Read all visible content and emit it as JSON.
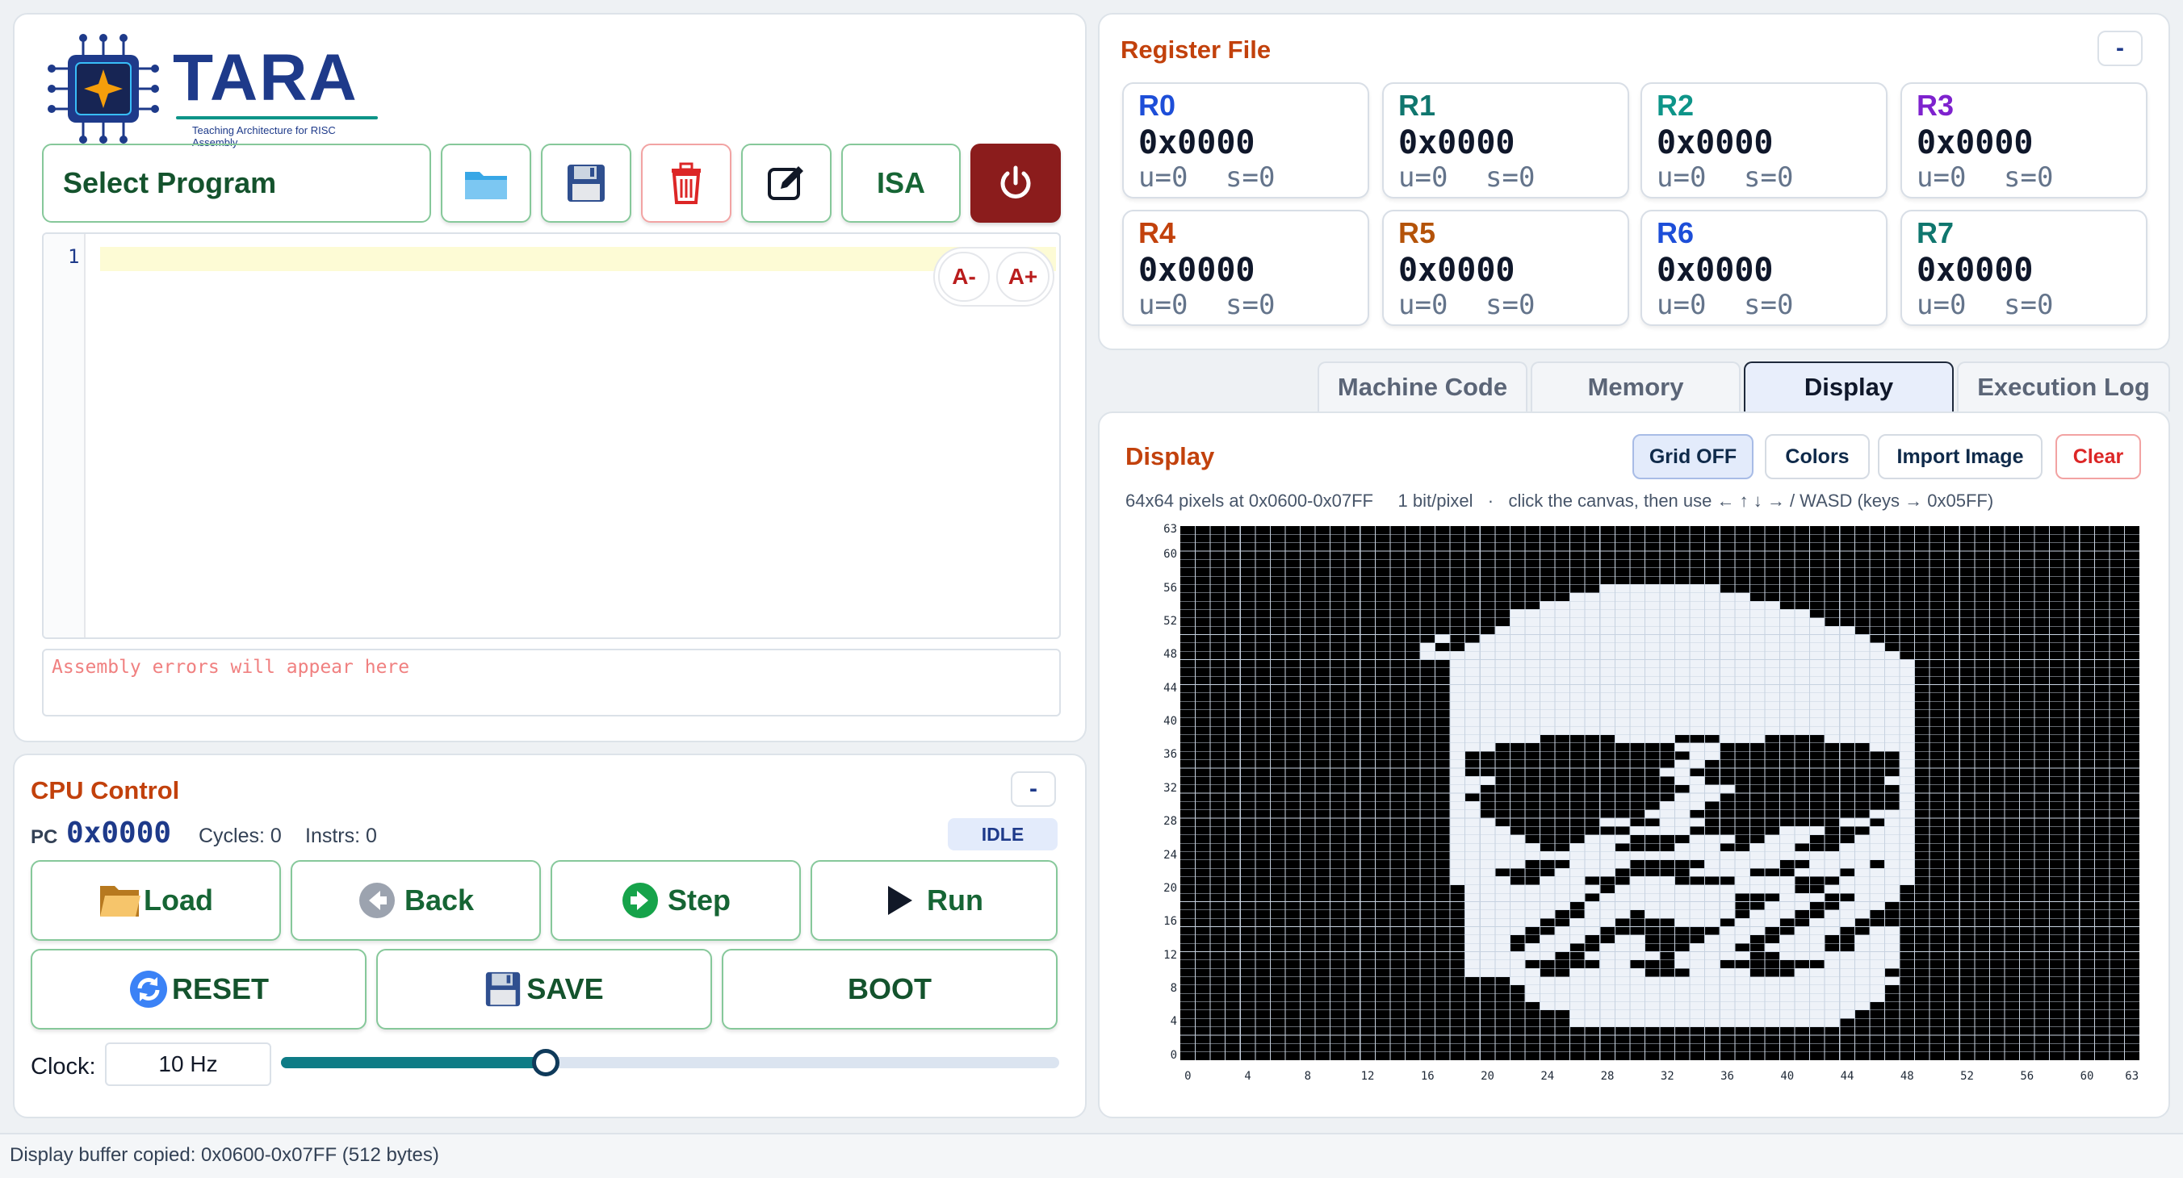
{
  "brand": {
    "name": "TARA",
    "tagline": "Teaching Architecture for RISC Assembly"
  },
  "toolbar": {
    "program_select": "Select Program",
    "isa_label": "ISA"
  },
  "editor": {
    "line_numbers": [
      "1"
    ],
    "font_decrease": "A-",
    "font_increase": "A+",
    "errors_placeholder": "Assembly errors will appear here"
  },
  "cpu": {
    "title": "CPU Control",
    "collapse": "-",
    "pc_label": "PC",
    "pc_value": "0x0000",
    "cycles": "Cycles: 0",
    "instrs": "Instrs: 0",
    "status": "IDLE",
    "buttons": {
      "load": "Load",
      "back": "Back",
      "step": "Step",
      "run": "Run",
      "reset": "RESET",
      "save": "SAVE",
      "boot": "BOOT"
    },
    "clock_label": "Clock:",
    "clock_value": "10 Hz",
    "clock_level_fraction": 0.34
  },
  "registers": {
    "title": "Register File",
    "collapse": "-",
    "items": [
      {
        "name": "R0",
        "value": "0x0000",
        "u": "u=0",
        "s": "s=0",
        "color": "#1d4ed8"
      },
      {
        "name": "R1",
        "value": "0x0000",
        "u": "u=0",
        "s": "s=0",
        "color": "#0f766e"
      },
      {
        "name": "R2",
        "value": "0x0000",
        "u": "u=0",
        "s": "s=0",
        "color": "#0d9488"
      },
      {
        "name": "R3",
        "value": "0x0000",
        "u": "u=0",
        "s": "s=0",
        "color": "#7e22ce"
      },
      {
        "name": "R4",
        "value": "0x0000",
        "u": "u=0",
        "s": "s=0",
        "color": "#c2410c"
      },
      {
        "name": "R5",
        "value": "0x0000",
        "u": "u=0",
        "s": "s=0",
        "color": "#b45309"
      },
      {
        "name": "R6",
        "value": "0x0000",
        "u": "u=0",
        "s": "s=0",
        "color": "#1d4ed8"
      },
      {
        "name": "R7",
        "value": "0x0000",
        "u": "u=0",
        "s": "s=0",
        "color": "#0f766e"
      }
    ]
  },
  "tabs": [
    "Machine Code",
    "Memory",
    "Display",
    "Execution Log"
  ],
  "display": {
    "title": "Display",
    "buttons": {
      "grid": "Grid OFF",
      "colors": "Colors",
      "import": "Import Image",
      "clear": "Clear"
    },
    "info": "64x64 pixels at 0x0600-0x07FF     1 bit/pixel   ·   click the canvas, then use ← ↑ ↓ → / WASD (keys → 0x05FF)",
    "y_ticks": [
      "0",
      "4",
      "8",
      "12",
      "16",
      "20",
      "24",
      "28",
      "32",
      "36",
      "40",
      "44",
      "48",
      "52",
      "56",
      "60",
      "63"
    ],
    "x_ticks": [
      "0",
      "4",
      "8",
      "12",
      "16",
      "20",
      "24",
      "28",
      "32",
      "36",
      "40",
      "44",
      "48",
      "52",
      "56",
      "60",
      "63"
    ],
    "size": 64,
    "lit_ranges": [
      [
        4,
        [
          [
            26,
            43
          ]
        ]
      ],
      [
        5,
        [
          [
            26,
            44
          ]
        ]
      ],
      [
        6,
        [
          [
            24,
            45
          ]
        ]
      ],
      [
        7,
        [
          [
            23,
            46
          ]
        ]
      ],
      [
        8,
        [
          [
            23,
            46
          ]
        ]
      ],
      [
        9,
        [
          [
            22,
            47
          ]
        ]
      ],
      [
        10,
        [
          [
            19,
            23
          ],
          [
            26,
            30
          ],
          [
            34,
            37
          ],
          [
            41,
            46
          ]
        ]
      ],
      [
        11,
        [
          [
            19,
            22
          ],
          [
            28,
            29
          ],
          [
            33,
            35
          ],
          [
            43,
            47
          ]
        ]
      ],
      [
        12,
        [
          [
            19,
            24
          ],
          [
            27,
            31
          ],
          [
            33,
            37
          ],
          [
            40,
            47
          ]
        ]
      ],
      [
        13,
        [
          [
            19,
            21
          ],
          [
            23,
            25
          ],
          [
            28,
            30
          ],
          [
            34,
            36
          ],
          [
            39,
            42
          ],
          [
            45,
            47
          ]
        ]
      ],
      [
        14,
        [
          [
            19,
            21
          ],
          [
            24,
            26
          ],
          [
            29,
            30
          ],
          [
            35,
            37
          ],
          [
            40,
            42
          ],
          [
            45,
            47
          ]
        ]
      ],
      [
        15,
        [
          [
            19,
            22
          ],
          [
            25,
            27
          ],
          [
            36,
            38
          ],
          [
            41,
            43
          ],
          [
            46,
            47
          ]
        ]
      ],
      [
        16,
        [
          [
            19,
            23
          ],
          [
            26,
            28
          ],
          [
            33,
            35
          ],
          [
            37,
            39
          ],
          [
            42,
            44
          ]
        ]
      ],
      [
        17,
        [
          [
            19,
            24
          ],
          [
            27,
            29
          ],
          [
            31,
            36
          ],
          [
            38,
            40
          ],
          [
            43,
            45
          ]
        ]
      ],
      [
        18,
        [
          [
            19,
            25
          ],
          [
            27,
            36
          ],
          [
            39,
            41
          ],
          [
            44,
            46
          ]
        ]
      ],
      [
        19,
        [
          [
            19,
            26
          ],
          [
            28,
            36
          ],
          [
            40,
            42
          ],
          [
            45,
            47
          ]
        ]
      ],
      [
        20,
        [
          [
            19,
            27
          ],
          [
            29,
            40
          ],
          [
            43,
            47
          ]
        ]
      ],
      [
        21,
        [
          [
            18,
            21
          ],
          [
            24,
            26
          ],
          [
            30,
            32
          ],
          [
            37,
            40
          ],
          [
            44,
            48
          ]
        ]
      ],
      [
        22,
        [
          [
            18,
            20
          ],
          [
            25,
            28
          ],
          [
            34,
            37
          ],
          [
            41,
            43
          ],
          [
            45,
            48
          ]
        ]
      ],
      [
        23,
        [
          [
            18,
            22
          ],
          [
            26,
            29
          ],
          [
            35,
            39
          ],
          [
            42,
            45
          ],
          [
            47,
            48
          ]
        ]
      ],
      [
        24,
        [
          [
            18,
            48
          ]
        ]
      ],
      [
        25,
        [
          [
            18,
            23
          ],
          [
            26,
            28
          ],
          [
            33,
            35
          ],
          [
            38,
            40
          ],
          [
            44,
            48
          ]
        ]
      ],
      [
        26,
        [
          [
            18,
            22
          ],
          [
            27,
            29
          ],
          [
            34,
            36
          ],
          [
            39,
            41
          ],
          [
            45,
            48
          ]
        ]
      ],
      [
        27,
        [
          [
            18,
            21
          ],
          [
            30,
            33
          ],
          [
            40,
            42
          ],
          [
            46,
            48
          ]
        ]
      ],
      [
        28,
        [
          [
            18,
            20
          ],
          [
            28,
            29
          ],
          [
            32,
            34
          ],
          [
            44,
            45
          ],
          [
            47,
            48
          ]
        ]
      ],
      [
        29,
        [
          [
            18,
            19
          ],
          [
            31,
            33
          ],
          [
            46,
            48
          ]
        ]
      ],
      [
        30,
        [
          [
            18,
            19
          ],
          [
            32,
            34
          ],
          [
            48,
            48
          ]
        ]
      ],
      [
        31,
        [
          [
            18,
            18
          ],
          [
            33,
            35
          ],
          [
            48,
            48
          ]
        ]
      ],
      [
        32,
        [
          [
            18,
            19
          ],
          [
            34,
            36
          ],
          [
            48,
            48
          ]
        ]
      ],
      [
        33,
        [
          [
            18,
            20
          ],
          [
            33,
            34
          ],
          [
            47,
            48
          ]
        ]
      ],
      [
        34,
        [
          [
            18,
            18
          ],
          [
            32,
            33
          ],
          [
            48,
            48
          ]
        ]
      ],
      [
        35,
        [
          [
            18,
            18
          ],
          [
            33,
            34
          ],
          [
            48,
            48
          ]
        ]
      ],
      [
        36,
        [
          [
            18,
            18
          ],
          [
            34,
            35
          ],
          [
            48,
            48
          ]
        ]
      ],
      [
        37,
        [
          [
            18,
            20
          ],
          [
            33,
            35
          ],
          [
            46,
            48
          ]
        ]
      ],
      [
        38,
        [
          [
            18,
            23
          ],
          [
            29,
            32
          ],
          [
            36,
            38
          ],
          [
            43,
            48
          ]
        ]
      ],
      [
        39,
        [
          [
            18,
            48
          ]
        ]
      ],
      [
        40,
        [
          [
            18,
            48
          ]
        ]
      ],
      [
        41,
        [
          [
            18,
            48
          ]
        ]
      ],
      [
        42,
        [
          [
            18,
            48
          ]
        ]
      ],
      [
        43,
        [
          [
            18,
            48
          ]
        ]
      ],
      [
        44,
        [
          [
            18,
            48
          ]
        ]
      ],
      [
        45,
        [
          [
            18,
            48
          ]
        ]
      ],
      [
        46,
        [
          [
            18,
            48
          ]
        ]
      ],
      [
        47,
        [
          [
            18,
            48
          ]
        ]
      ],
      [
        48,
        [
          [
            16,
            17
          ],
          [
            18,
            47
          ]
        ]
      ],
      [
        49,
        [
          [
            16,
            16
          ],
          [
            19,
            46
          ]
        ]
      ],
      [
        50,
        [
          [
            17,
            17
          ],
          [
            20,
            45
          ]
        ]
      ],
      [
        51,
        [
          [
            21,
            44
          ]
        ]
      ],
      [
        52,
        [
          [
            22,
            42
          ]
        ]
      ],
      [
        53,
        [
          [
            22,
            41
          ]
        ]
      ],
      [
        54,
        [
          [
            24,
            39
          ]
        ]
      ],
      [
        55,
        [
          [
            26,
            37
          ]
        ]
      ],
      [
        56,
        [
          [
            28,
            35
          ]
        ]
      ]
    ]
  },
  "status_bar": "Display buffer copied: 0x0600-0x07FF (512 bytes)"
}
